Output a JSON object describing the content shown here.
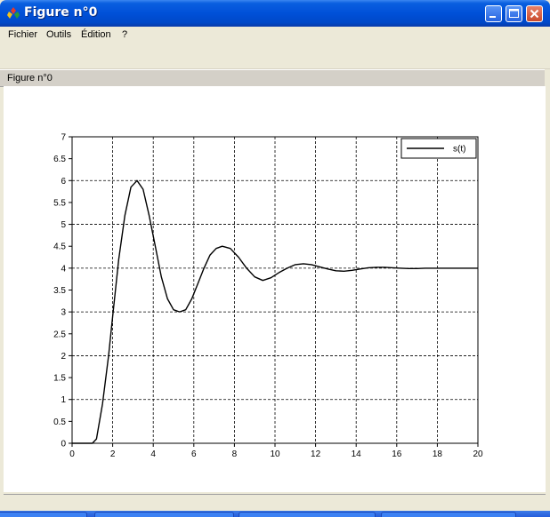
{
  "window": {
    "title": "Figure n°0"
  },
  "menu": {
    "items": [
      "Fichier",
      "Outils",
      "Édition",
      "?"
    ]
  },
  "axes_bar": {
    "label": "Figure n°0"
  },
  "taskbar": {
    "tasks": [
      "",
      "",
      "",
      ""
    ]
  },
  "colors": {
    "title_bar": "#0050d8",
    "window_bg": "#ece9d8",
    "plot_line": "#000000"
  },
  "icons": {
    "app": "scilab-icon",
    "minimize": "minimize-icon",
    "maximize": "maximize-icon",
    "close": "close-icon"
  },
  "chart_data": {
    "type": "line",
    "title": "",
    "xlabel": "",
    "ylabel": "",
    "xlim": [
      0,
      20
    ],
    "ylim": [
      0,
      7
    ],
    "x_ticks": [
      0,
      2,
      4,
      6,
      8,
      10,
      12,
      14,
      16,
      18,
      20
    ],
    "y_ticks": [
      0,
      0.5,
      1,
      1.5,
      2,
      2.5,
      3,
      3.5,
      4,
      4.5,
      5,
      5.5,
      6,
      6.5,
      7
    ],
    "grid": true,
    "legend_position": "top-right",
    "series": [
      {
        "name": "s(t)",
        "x": [
          0,
          0.5,
          1.0,
          1.2,
          1.5,
          1.8,
          2.0,
          2.3,
          2.6,
          2.9,
          3.2,
          3.5,
          3.8,
          4.1,
          4.4,
          4.7,
          5.0,
          5.3,
          5.6,
          5.9,
          6.2,
          6.5,
          6.8,
          7.1,
          7.4,
          7.8,
          8.2,
          8.6,
          9.0,
          9.4,
          9.8,
          10.2,
          10.6,
          11.0,
          11.4,
          11.8,
          12.2,
          12.6,
          13.0,
          13.4,
          13.8,
          14.2,
          14.6,
          15.0,
          15.4,
          15.8,
          16.2,
          16.6,
          17.0,
          17.4,
          17.8,
          18.2,
          18.6,
          19.0,
          19.4,
          20.0
        ],
        "y": [
          0,
          0,
          0,
          0.1,
          0.9,
          2.0,
          2.9,
          4.2,
          5.2,
          5.85,
          6.0,
          5.8,
          5.2,
          4.5,
          3.8,
          3.3,
          3.05,
          3.0,
          3.05,
          3.3,
          3.65,
          4.0,
          4.3,
          4.45,
          4.5,
          4.45,
          4.25,
          4.0,
          3.8,
          3.72,
          3.78,
          3.9,
          4.0,
          4.08,
          4.1,
          4.08,
          4.03,
          3.98,
          3.94,
          3.93,
          3.95,
          3.98,
          4.01,
          4.02,
          4.02,
          4.01,
          4.0,
          3.99,
          3.99,
          4.0,
          4.0,
          4.0,
          4.0,
          4.0,
          4.0,
          4.0
        ]
      }
    ]
  }
}
